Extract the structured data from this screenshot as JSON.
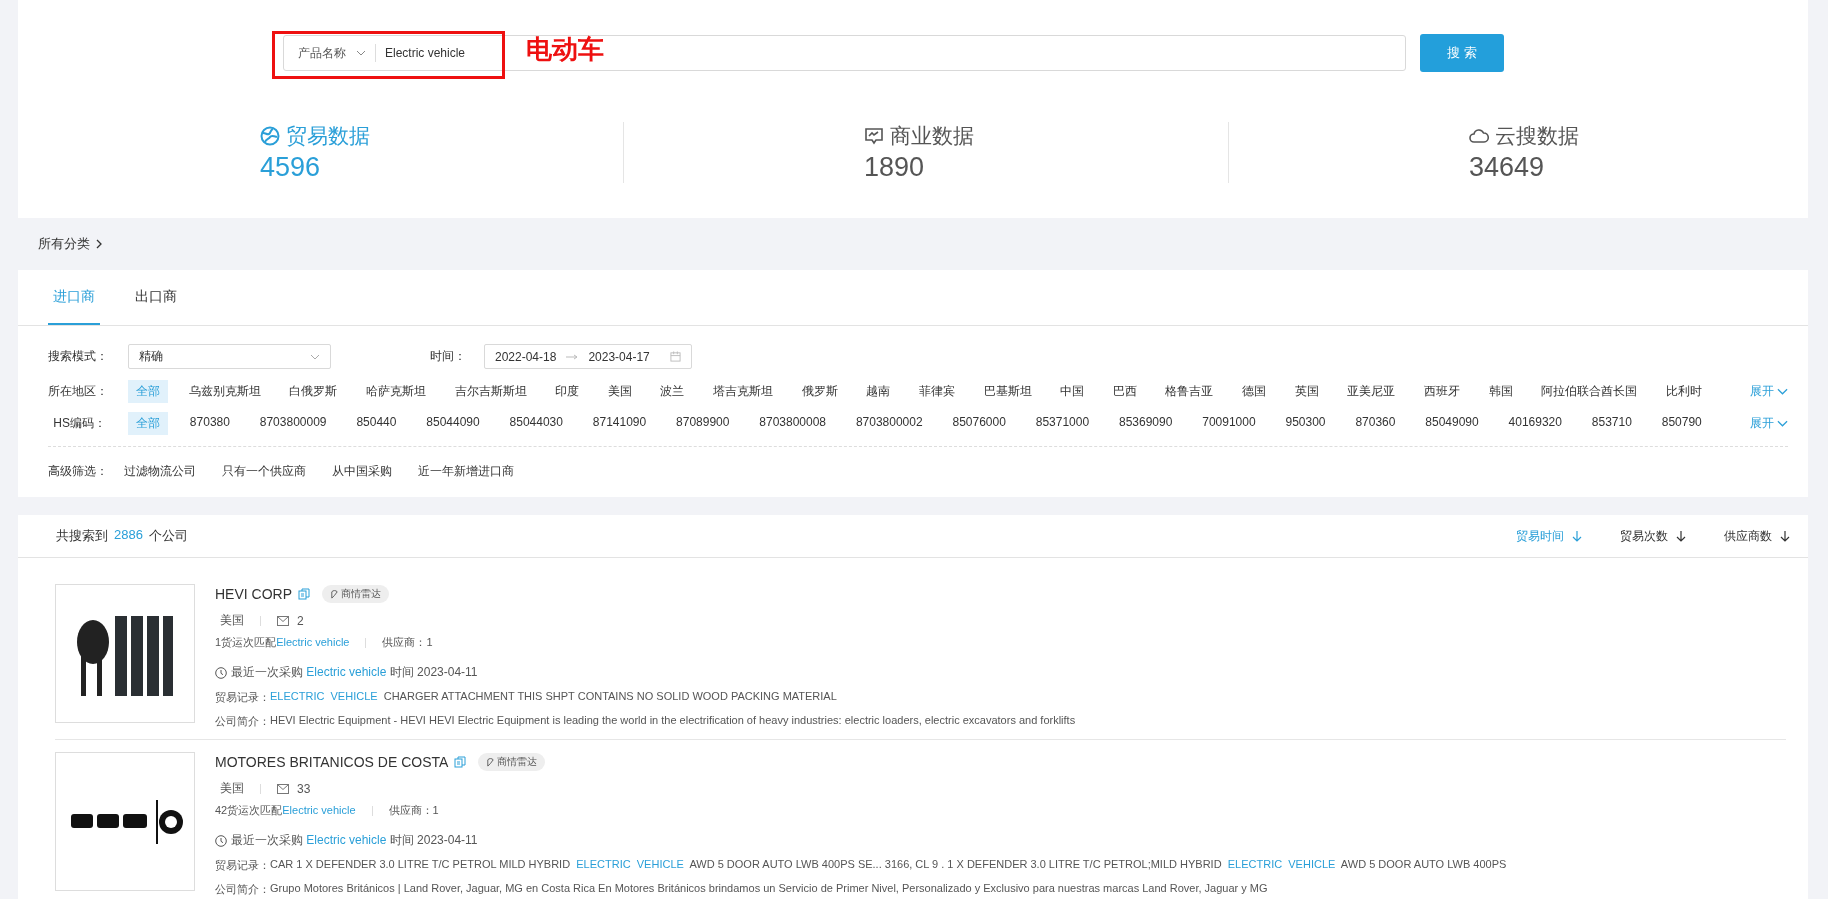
{
  "search": {
    "field_select": "产品名称",
    "value": "Electric vehicle",
    "button": "搜 索",
    "annotation": "电动车"
  },
  "stats": [
    {
      "kind": "globe",
      "label": "贸易数据",
      "value": "4596",
      "selected": true
    },
    {
      "kind": "chat",
      "label": "商业数据",
      "value": "1890",
      "selected": false
    },
    {
      "kind": "cloud",
      "label": "云搜数据",
      "value": "34649",
      "selected": false
    }
  ],
  "breadcrumb": "所有分类",
  "tabs": [
    {
      "label": "进口商",
      "selected": true
    },
    {
      "label": "出口商",
      "selected": false
    }
  ],
  "filters": {
    "mode_label": "搜索模式：",
    "mode_value": "精确",
    "time_label": "时间：",
    "date_from": "2022-04-18",
    "date_to": "2023-04-17",
    "region_label": "所在地区：",
    "regions": [
      {
        "label": "全部",
        "selected": true
      },
      {
        "label": "乌兹别克斯坦",
        "selected": false
      },
      {
        "label": "白俄罗斯",
        "selected": false
      },
      {
        "label": "哈萨克斯坦",
        "selected": false
      },
      {
        "label": "吉尔吉斯斯坦",
        "selected": false
      },
      {
        "label": "印度",
        "selected": false
      },
      {
        "label": "美国",
        "selected": false
      },
      {
        "label": "波兰",
        "selected": false
      },
      {
        "label": "塔吉克斯坦",
        "selected": false
      },
      {
        "label": "俄罗斯",
        "selected": false
      },
      {
        "label": "越南",
        "selected": false
      },
      {
        "label": "菲律宾",
        "selected": false
      },
      {
        "label": "巴基斯坦",
        "selected": false
      },
      {
        "label": "中国",
        "selected": false
      },
      {
        "label": "巴西",
        "selected": false
      },
      {
        "label": "格鲁吉亚",
        "selected": false
      },
      {
        "label": "德国",
        "selected": false
      },
      {
        "label": "英国",
        "selected": false
      },
      {
        "label": "亚美尼亚",
        "selected": false
      },
      {
        "label": "西班牙",
        "selected": false
      },
      {
        "label": "韩国",
        "selected": false
      },
      {
        "label": "阿拉伯联合酋长国",
        "selected": false
      },
      {
        "label": "比利时",
        "selected": false
      }
    ],
    "region_expand": "展开",
    "hs_label": "HS编码：",
    "hs_codes": [
      {
        "label": "全部",
        "selected": true
      },
      {
        "label": "870380",
        "selected": false
      },
      {
        "label": "8703800009",
        "selected": false
      },
      {
        "label": "850440",
        "selected": false
      },
      {
        "label": "85044090",
        "selected": false
      },
      {
        "label": "85044030",
        "selected": false
      },
      {
        "label": "87141090",
        "selected": false
      },
      {
        "label": "87089900",
        "selected": false
      },
      {
        "label": "8703800008",
        "selected": false
      },
      {
        "label": "8703800002",
        "selected": false
      },
      {
        "label": "85076000",
        "selected": false
      },
      {
        "label": "85371000",
        "selected": false
      },
      {
        "label": "85369090",
        "selected": false
      },
      {
        "label": "70091000",
        "selected": false
      },
      {
        "label": "950300",
        "selected": false
      },
      {
        "label": "870360",
        "selected": false
      },
      {
        "label": "85049090",
        "selected": false
      },
      {
        "label": "40169320",
        "selected": false
      },
      {
        "label": "853710",
        "selected": false
      },
      {
        "label": "850790",
        "selected": false
      }
    ],
    "hs_expand": "展开",
    "advanced_label": "高级筛选：",
    "advanced": [
      "过滤物流公司",
      "只有一个供应商",
      "从中国采购",
      "近一年新增进口商"
    ]
  },
  "results": {
    "prefix": "共搜索到",
    "count": "2886",
    "suffix": "个公司",
    "sort": [
      {
        "label": "贸易时间",
        "selected": true
      },
      {
        "label": "贸易次数",
        "selected": false
      },
      {
        "label": "供应商数",
        "selected": false
      }
    ],
    "companies": [
      {
        "logo": {
          "kind": "picture"
        },
        "name": "HEVI CORP",
        "badge": "商情雷达",
        "country": "美国",
        "emails": "2",
        "matches": [
          {
            "text": "1货运次匹配",
            "highlight": false
          },
          {
            "text": "Electric vehicle",
            "highlight": true
          }
        ],
        "suppliers": "供应商：1",
        "last_purchase": [
          {
            "text": "最近一次采购",
            "highlight": false
          },
          {
            "text": "Electric vehicle",
            "highlight": true
          },
          {
            "text": "时间 2023-04-11",
            "highlight": false
          }
        ],
        "record_label": "贸易记录：",
        "record": [
          {
            "text": "ELECTRIC",
            "highlight": true
          },
          {
            "text": "VEHICLE",
            "highlight": true
          },
          {
            "text": "CHARGER ATTACHMENT THIS SHPT CONTAINS NO SOLID WOOD PACKING MATERIAL",
            "highlight": false
          }
        ],
        "intro_label": "公司简介：",
        "intro": "HEVI Electric Equipment - HEVI HEVI Electric Equipment is leading the world in the electrification of heavy industries: electric loaders, electric excavators and forklifts"
      },
      {
        "logo": {
          "kind": "picture"
        },
        "name": "MOTORES BRITANICOS DE COSTA",
        "badge": "商情雷达",
        "country": "美国",
        "emails": "33",
        "matches": [
          {
            "text": "42货运次匹配",
            "highlight": false
          },
          {
            "text": "Electric vehicle",
            "highlight": true
          }
        ],
        "suppliers": "供应商：1",
        "last_purchase": [
          {
            "text": "最近一次采购",
            "highlight": false
          },
          {
            "text": "Electric vehicle",
            "highlight": true
          },
          {
            "text": "时间 2023-04-11",
            "highlight": false
          }
        ],
        "record_label": "贸易记录：",
        "record": [
          {
            "text": "CAR 1 X DEFENDER 3.0 LITRE T/C PETROL MILD HYBRID",
            "highlight": false
          },
          {
            "text": "ELECTRIC",
            "highlight": true
          },
          {
            "text": "VEHICLE",
            "highlight": true
          },
          {
            "text": "AWD 5 DOOR AUTO LWB 400PS SE... 3166, CL 9 . 1 X DEFENDER 3.0 LITRE T/C PETROL;MILD HYBRID",
            "highlight": false
          },
          {
            "text": "ELECTRIC",
            "highlight": true
          },
          {
            "text": "VEHICLE",
            "highlight": true
          },
          {
            "text": "AWD 5 DOOR AUTO LWB 400PS",
            "highlight": false
          }
        ],
        "intro_label": "公司简介：",
        "intro": "Grupo Motores Británicos | Land Rover, Jaguar, MG en Costa Rica En Motores Británicos brindamos un Servicio de Primer Nivel, Personalizado y Exclusivo para nuestras marcas Land Rover, Jaguar y MG"
      }
    ]
  }
}
